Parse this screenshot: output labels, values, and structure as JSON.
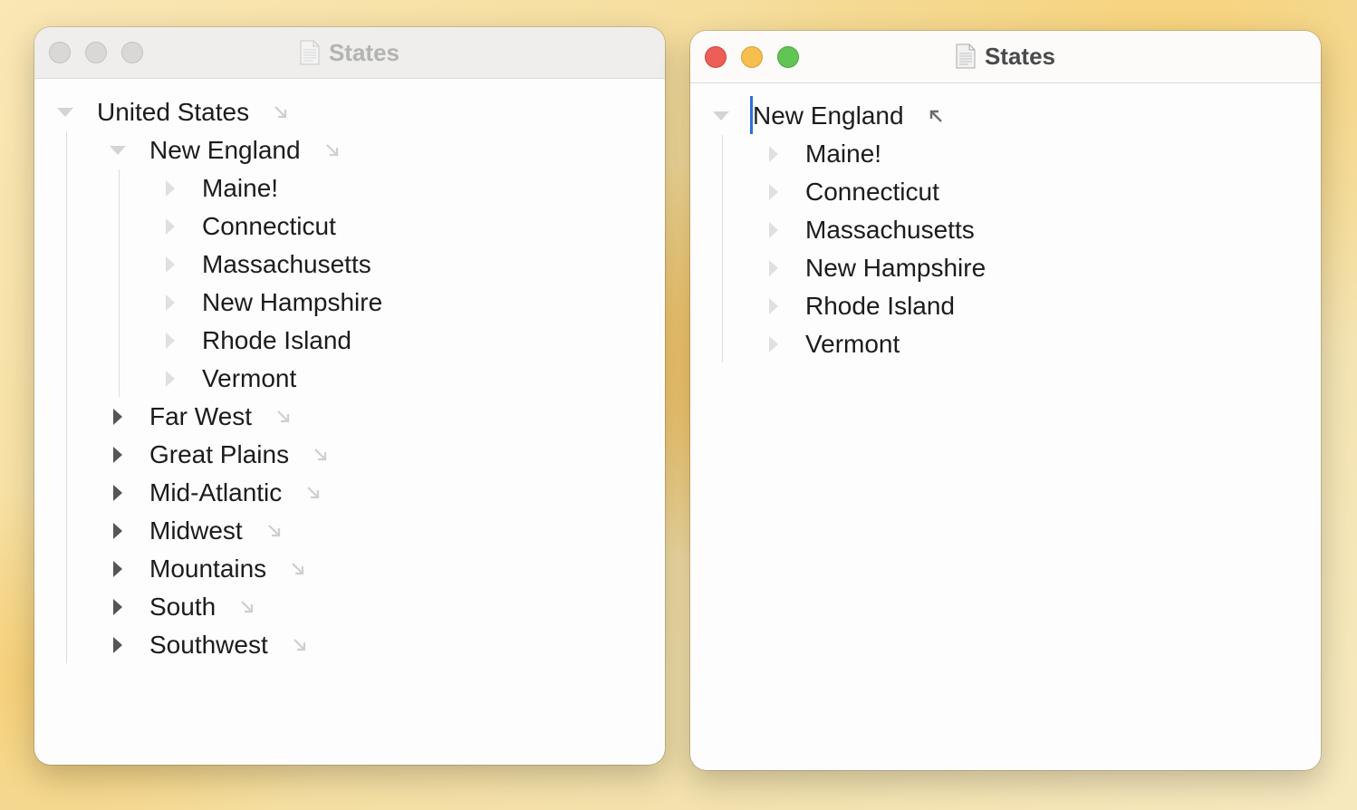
{
  "windows": [
    {
      "title": "States",
      "active": false,
      "outline": {
        "root": {
          "label": "United States",
          "expanded": true
        },
        "group": {
          "label": "New England",
          "expanded": true
        },
        "children": [
          "Maine!",
          "Connecticut",
          "Massachusetts",
          "New Hampshire",
          "Rhode Island",
          "Vermont"
        ],
        "siblings": [
          "Far West",
          "Great Plains",
          "Mid-Atlantic",
          "Midwest",
          "Mountains",
          "South",
          "Southwest"
        ]
      }
    },
    {
      "title": "States",
      "active": true,
      "outline": {
        "root": {
          "label": "New England",
          "expanded": true,
          "hoisted": true
        },
        "children": [
          "Maine!",
          "Connecticut",
          "Massachusetts",
          "New Hampshire",
          "Rhode Island",
          "Vermont"
        ]
      }
    }
  ],
  "icons": {
    "hoist": "arrow-down-right-icon",
    "unhoist": "arrow-up-left-icon",
    "document": "document-icon",
    "collapsed": "triangle-right-icon",
    "expanded": "triangle-down-icon"
  },
  "colors": {
    "close": "#ec5f59",
    "minimize": "#f5be4f",
    "zoom": "#61c455",
    "insertion_point": "#2f6fe0"
  }
}
